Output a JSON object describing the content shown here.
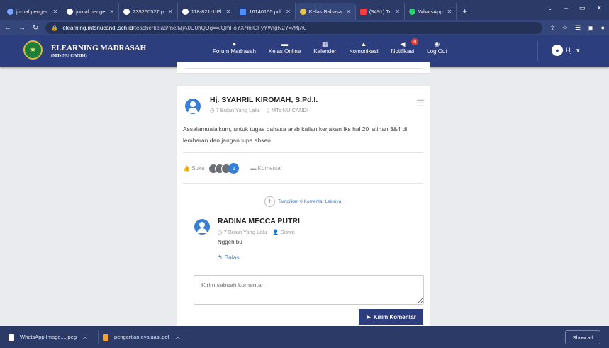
{
  "browser": {
    "tabs": [
      {
        "title": "jurnal pengen",
        "color": "#7aa7ff"
      },
      {
        "title": "jurnal penge",
        "color": "#ffffff"
      },
      {
        "title": "235260527.p",
        "color": "#ffffff"
      },
      {
        "title": "118-821-1-Pl",
        "color": "#ffffff"
      },
      {
        "title": "16140155.pdf",
        "color": "#4f8ef7"
      },
      {
        "title": "Kelas Bahasa",
        "color": "#e8c44a",
        "active": true
      },
      {
        "title": "(3491) Tr",
        "color": "#ff3d3d"
      },
      {
        "title": "WhatsApp",
        "color": "#25d366"
      }
    ],
    "new_tab": "+",
    "window_controls": [
      "⌄",
      "–",
      "▭",
      "✕"
    ],
    "address": {
      "domain": "elearning.mtsnucandi.sch.id",
      "path": "/teacherkelas/me/MjA0U0hQUg==/QmFoYXNhIGFyYWIgN2Y=/MjA0"
    }
  },
  "site": {
    "brand_title": "ELEARNING MADRASAH",
    "brand_subtitle": "(MTs NU CANDI)",
    "nav": [
      {
        "label": "Forum Madrasah",
        "icon": "chat-icon"
      },
      {
        "label": "Kelas Online",
        "icon": "graduation-cap-icon"
      },
      {
        "label": "Kalender",
        "icon": "calendar-icon"
      },
      {
        "label": "Komunikasi",
        "icon": "bell-icon"
      },
      {
        "label": "Notifikasi",
        "icon": "megaphone-icon",
        "badge": "0"
      },
      {
        "label": "Log Out",
        "icon": "logout-icon"
      }
    ],
    "user": "Hj."
  },
  "post": {
    "author": "Hj. SYAHRIL KIROMAH, S.Pd.I.",
    "time": "7 Bulan Yang Lalu",
    "school": "MTs NU CANDI",
    "body": "Assalamualaikum, untuk tugas bahasa arab kalian kerjakan lks hal 20 latihan 3&4 di lembaran dan jangan lupa absen",
    "like_label": "Suka",
    "like_count": "1",
    "comment_label": "Komentar",
    "show_more": "Tampilkan 0 Komentar Lainnya"
  },
  "comment": {
    "author": "RADINA MECCA PUTRI",
    "time": "7 Bulan Yang Lalu",
    "role": "Siswa",
    "text": "Nggeh bu",
    "reply_label": "Balas"
  },
  "composer": {
    "placeholder": "Kirim sebuah komentar",
    "submit_label": "Kirim Komentar"
  },
  "downloads": {
    "items": [
      "WhatsApp Image....jpeg",
      "pengertian evaluasi.pdf"
    ],
    "show_all": "Show all"
  },
  "colors": {
    "nav_bg": "#2d3e7e",
    "accent": "#3a7fd6",
    "badge": "#e53935"
  }
}
